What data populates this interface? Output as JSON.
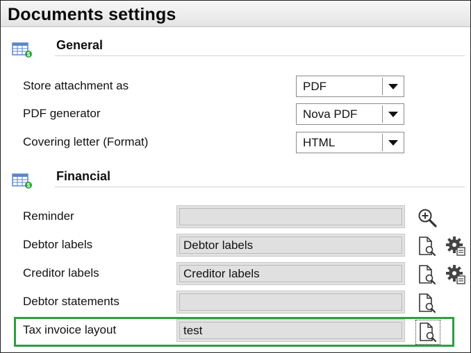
{
  "window": {
    "title": "Documents settings"
  },
  "general": {
    "title": "General",
    "icon": "table-sheet-icon",
    "rows": [
      {
        "label": "Store attachment as",
        "value": "PDF"
      },
      {
        "label": "PDF generator",
        "value": "Nova PDF"
      },
      {
        "label": "Covering letter (Format)",
        "value": "HTML"
      }
    ]
  },
  "financial": {
    "title": "Financial",
    "icon": "table-sheet-icon",
    "rows": [
      {
        "label": "Reminder",
        "value": "",
        "buttons": [
          "zoom-in-icon"
        ]
      },
      {
        "label": "Debtor labels",
        "value": "Debtor labels",
        "buttons": [
          "document-search-icon",
          "gear-settings-icon"
        ]
      },
      {
        "label": "Creditor labels",
        "value": "Creditor labels",
        "buttons": [
          "document-search-icon",
          "gear-settings-icon"
        ]
      },
      {
        "label": "Debtor statements",
        "value": "",
        "buttons": [
          "document-search-icon"
        ]
      },
      {
        "label": "Tax invoice layout",
        "value": "test",
        "buttons": [
          "document-search-icon"
        ]
      }
    ]
  },
  "colors": {
    "highlight": "#2e9e3e",
    "section_icon_blue": "#5b86c9",
    "section_icon_green": "#2e9e3e",
    "field_bg": "#e3e3e3"
  }
}
